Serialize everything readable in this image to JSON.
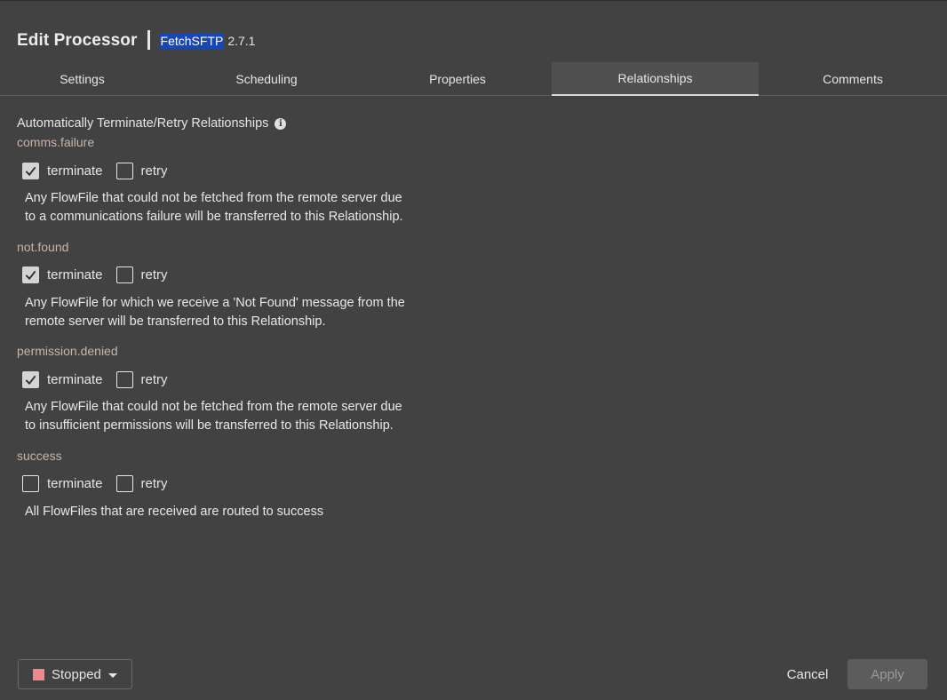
{
  "header": {
    "title": "Edit Processor",
    "processor_name": "FetchSFTP",
    "processor_version": "2.7.1"
  },
  "tabs": [
    {
      "label": "Settings",
      "active": false
    },
    {
      "label": "Scheduling",
      "active": false
    },
    {
      "label": "Properties",
      "active": false
    },
    {
      "label": "Relationships",
      "active": true
    },
    {
      "label": "Comments",
      "active": false
    }
  ],
  "section_title": "Automatically Terminate/Retry Relationships",
  "option_labels": {
    "terminate": "terminate",
    "retry": "retry"
  },
  "relationships": [
    {
      "name": "comms.failure",
      "terminate": true,
      "retry": false,
      "description_lines": [
        "Any FlowFile that could not be fetched from the remote server due",
        "to a communications failure will be transferred to this Relationship."
      ]
    },
    {
      "name": "not.found",
      "terminate": true,
      "retry": false,
      "description_lines": [
        "Any FlowFile for which we receive a 'Not Found' message from the",
        "remote server will be transferred to this Relationship."
      ]
    },
    {
      "name": "permission.denied",
      "terminate": true,
      "retry": false,
      "description_lines": [
        "Any FlowFile that could not be fetched from the remote server due",
        "to insufficient permissions will be transferred to this Relationship."
      ]
    },
    {
      "name": "success",
      "terminate": false,
      "retry": false,
      "description_lines": [
        "All FlowFiles that are received are routed to success"
      ]
    }
  ],
  "footer": {
    "status_label": "Stopped",
    "status_color": "#f0898c",
    "cancel_label": "Cancel",
    "apply_label": "Apply"
  }
}
